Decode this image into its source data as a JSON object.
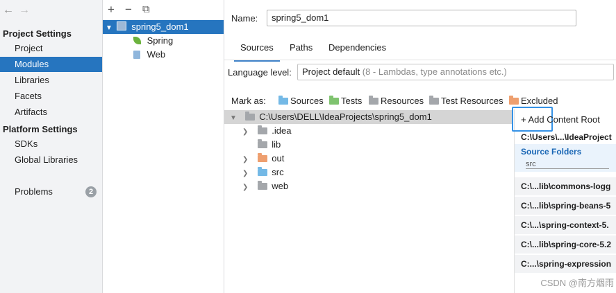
{
  "nav": {
    "back": "←",
    "forward": "→"
  },
  "sidebar": {
    "project_settings_title": "Project Settings",
    "project_items": [
      "Project",
      "Modules",
      "Libraries",
      "Facets",
      "Artifacts"
    ],
    "platform_settings_title": "Platform Settings",
    "platform_items": [
      "SDKs",
      "Global Libraries"
    ],
    "problems_label": "Problems",
    "problems_count": "2",
    "selected": "Modules"
  },
  "module_tree": {
    "toolbar": {
      "add": "+",
      "remove": "−",
      "copy": "⧉"
    },
    "module_name": "spring5_dom1",
    "children": [
      "Spring",
      "Web"
    ]
  },
  "main": {
    "name_label": "Name:",
    "name_value": "spring5_dom1",
    "tabs": [
      "Sources",
      "Paths",
      "Dependencies"
    ],
    "active_tab": "Sources",
    "language_level_label": "Language level:",
    "language_level_value": "Project default",
    "language_level_hint": "(8 - Lambdas, type annotations etc.)",
    "mark_as_label": "Mark as:",
    "mark_buttons": [
      {
        "label": "Sources",
        "color": "#74b9e6"
      },
      {
        "label": "Tests",
        "color": "#7fc36f"
      },
      {
        "label": "Resources",
        "color": "#a4a7ab"
      },
      {
        "label": "Test Resources",
        "color": "#a4a7ab"
      },
      {
        "label": "Excluded",
        "color": "#ee9f6f"
      }
    ]
  },
  "content_tree": {
    "root": "C:\\Users\\DELL\\IdeaProjects\\spring5_dom1",
    "folders": [
      {
        "name": ".idea",
        "color": "#a4a7ab",
        "expandable": true
      },
      {
        "name": "lib",
        "color": "#a4a7ab",
        "expandable": false
      },
      {
        "name": "out",
        "color": "#ee9f6f",
        "expandable": true
      },
      {
        "name": "src",
        "color": "#74b9e6",
        "expandable": true
      },
      {
        "name": "web",
        "color": "#a4a7ab",
        "expandable": true
      }
    ]
  },
  "root_panel": {
    "add_button": "+ Add Content Root",
    "root_path": "C:\\Users\\...\\IdeaProject",
    "source_folders_title": "Source Folders",
    "source_folder": "src",
    "libs": [
      "C:\\...lib\\commons-logg",
      "C:\\...lib\\spring-beans-5",
      "C:\\...\\spring-context-5.",
      "C:\\...lib\\spring-core-5.2",
      "C:...\\spring-expression"
    ],
    "watermark": "CSDN @南方烟雨"
  },
  "colors": {
    "accent": "#2675bf",
    "focus": "#3592e6",
    "source_blue": "#1a67b5"
  }
}
